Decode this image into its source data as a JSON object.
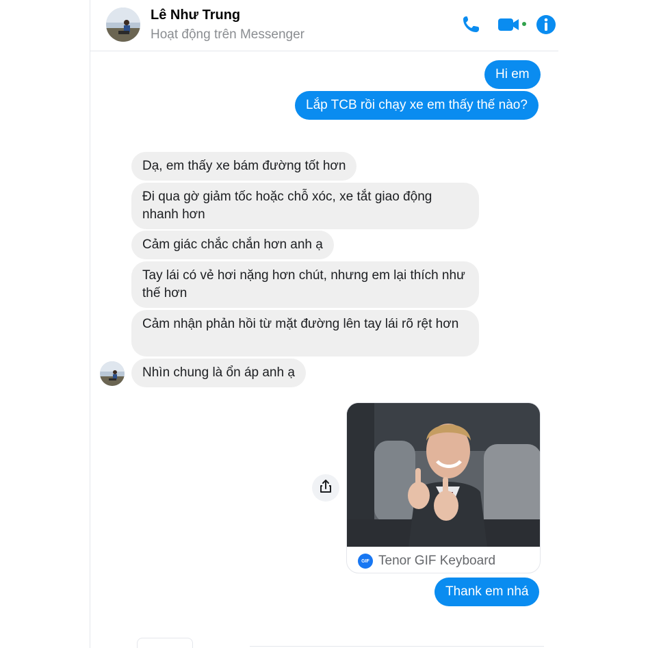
{
  "header": {
    "contact_name": "Lê Như Trung",
    "status": "Hoạt động trên Messenger",
    "icons": [
      "phone-icon",
      "video-call-icon",
      "info-icon"
    ],
    "accent_color": "#0a8cf0",
    "online_dot_color": "#31a24c"
  },
  "messages": {
    "out_1": "Hi em",
    "out_2": "Lắp TCB rồi chạy xe em thấy thế nào?",
    "in_1": "Dạ, em thấy xe bám đường tốt hơn",
    "in_2": "Đi qua gờ giảm tốc hoặc chỗ xóc, xe tắt giao động nhanh hơn",
    "in_3": "Cảm giác chắc chắn hơn anh ạ",
    "in_4": "Tay lái có vẻ hơi nặng hơn chút, nhưng em lại thích như thế hơn",
    "in_5": "Cảm nhận phản hồi từ mặt đường lên tay lái rõ rệt hơn",
    "in_6": "Nhìn chung là ổn áp anh ạ",
    "gif_source": "Tenor GIF Keyboard",
    "gif_badge": "GIF",
    "out_3": "Thank em nhá"
  },
  "colors": {
    "outgoing_bubble": "#0a8cf0",
    "incoming_bubble": "#efefef"
  }
}
